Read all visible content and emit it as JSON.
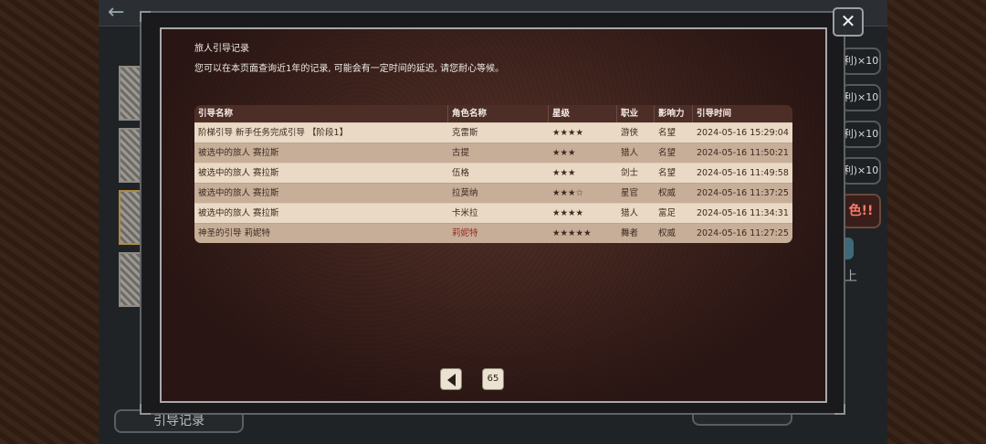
{
  "window": {
    "close_label": "✕",
    "back_label": "←"
  },
  "dialog": {
    "title": "旅人引导记录",
    "subtitle": "您可以在本页面查询近1年的记录, 可能会有一定时间的延迟, 请您耐心等候。"
  },
  "table": {
    "headers": [
      "引导名称",
      "角色名称",
      "星级",
      "职业",
      "影响力",
      "引导时间"
    ],
    "rows": [
      {
        "name": "阶梯引导 新手任务完成引导 【阶段1】",
        "role": "克雷斯",
        "stars": "★★★★",
        "job": "游侠",
        "influence": "名望",
        "time": "2024-05-16 15:29:04",
        "highlight": false
      },
      {
        "name": "被选中的旅人 赛拉斯",
        "role": "古提",
        "stars": "★★★",
        "job": "猎人",
        "influence": "名望",
        "time": "2024-05-16 11:50:21",
        "highlight": false
      },
      {
        "name": "被选中的旅人 赛拉斯",
        "role": "伍格",
        "stars": "★★★",
        "job": "剑士",
        "influence": "名望",
        "time": "2024-05-16 11:49:58",
        "highlight": false
      },
      {
        "name": "被选中的旅人 赛拉斯",
        "role": "拉莫纳",
        "stars": "★★★☆",
        "job": "星官",
        "influence": "权威",
        "time": "2024-05-16 11:37:25",
        "highlight": false
      },
      {
        "name": "被选中的旅人 赛拉斯",
        "role": "卡米拉",
        "stars": "★★★★",
        "job": "猎人",
        "influence": "富足",
        "time": "2024-05-16 11:34:31",
        "highlight": false
      },
      {
        "name": "神圣的引导 莉妮特",
        "role": "莉妮特",
        "stars": "★★★★★",
        "job": "舞者",
        "influence": "权威",
        "time": "2024-05-16 11:27:25",
        "highlight": true
      }
    ]
  },
  "pagination": {
    "page": "65"
  },
  "background": {
    "right_buttons": [
      "利)×10",
      "利)×10",
      "利)×10",
      "利)×10"
    ],
    "right_red_label": "色!!",
    "right_text": "上",
    "bottom_left_button": "引导记录"
  },
  "colors": {
    "accent_red": "#9b2a1f",
    "row_light": "#ead9c4",
    "row_dark": "#c6ae98",
    "header": "#4d2e27"
  }
}
